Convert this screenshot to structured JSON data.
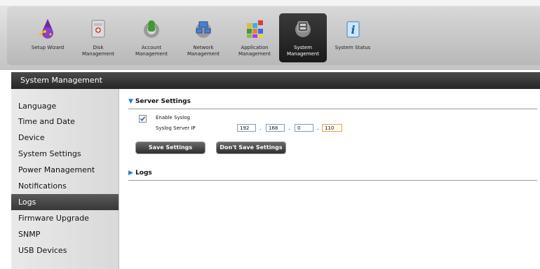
{
  "nav": {
    "items": [
      {
        "label": "Setup Wizard",
        "icon": "wizard-icon"
      },
      {
        "label": "Disk\nManagement",
        "icon": "disk-icon"
      },
      {
        "label": "Account\nManagement",
        "icon": "account-icon"
      },
      {
        "label": "Network\nManagement",
        "icon": "network-icon"
      },
      {
        "label": "Application\nManagement",
        "icon": "application-icon"
      },
      {
        "label": "System\nManagement",
        "icon": "system-icon",
        "active": true
      },
      {
        "label": "System Status",
        "icon": "info-icon"
      }
    ]
  },
  "page": {
    "title": "System Management"
  },
  "sidebar": {
    "items": [
      {
        "label": "Language"
      },
      {
        "label": "Time and Date"
      },
      {
        "label": "Device"
      },
      {
        "label": "System Settings"
      },
      {
        "label": "Power Management"
      },
      {
        "label": "Notifications"
      },
      {
        "label": "Logs",
        "active": true
      },
      {
        "label": "Firmware Upgrade"
      },
      {
        "label": "SNMP"
      },
      {
        "label": "USB Devices"
      }
    ]
  },
  "server_settings": {
    "heading": "Server Settings",
    "enable_syslog_label": "Enable Syslog",
    "enable_syslog_checked": true,
    "syslog_ip_label": "Syslog Server IP",
    "ip": [
      "192",
      "168",
      "0",
      "110"
    ],
    "ip_separator": ".",
    "save_label": "Save Settings",
    "dont_save_label": "Don't Save Settings"
  },
  "logs": {
    "heading": "Logs"
  },
  "colors": {
    "accent": "#1e7fd8",
    "active_dark": "#262626"
  }
}
